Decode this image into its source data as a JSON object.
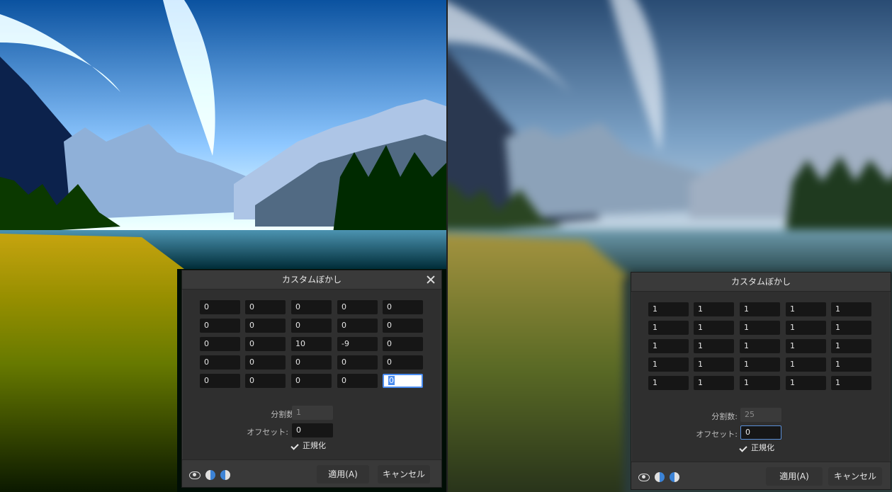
{
  "colors": {
    "dialog_bg": "#2f2f2f",
    "title_bar": "#3a3a3a",
    "cell_bg": "#161616",
    "accent": "#4a8cf0"
  },
  "left_dialog": {
    "title": "カスタムぼかし",
    "matrix": [
      [
        "0",
        "0",
        "0",
        "0",
        "0"
      ],
      [
        "0",
        "0",
        "0",
        "0",
        "0"
      ],
      [
        "0",
        "0",
        "10",
        "-9",
        "0"
      ],
      [
        "0",
        "0",
        "0",
        "0",
        "0"
      ],
      [
        "0",
        "0",
        "0",
        "0",
        "0"
      ]
    ],
    "division_label": "分割数:",
    "division_value": "1",
    "offset_label": "オフセット:",
    "offset_value": "0",
    "normalize_label": "正規化",
    "apply_label": "適用(A)",
    "cancel_label": "キャンセル"
  },
  "right_dialog": {
    "title": "カスタムぼかし",
    "matrix": [
      [
        "1",
        "1",
        "1",
        "1",
        "1"
      ],
      [
        "1",
        "1",
        "1",
        "1",
        "1"
      ],
      [
        "1",
        "1",
        "1",
        "1",
        "1"
      ],
      [
        "1",
        "1",
        "1",
        "1",
        "1"
      ],
      [
        "1",
        "1",
        "1",
        "1",
        "1"
      ]
    ],
    "division_label": "分割数:",
    "division_value": "25",
    "offset_label": "オフセット:",
    "offset_value": "0",
    "normalize_label": "正規化",
    "apply_label": "適用(A)",
    "cancel_label": "キャンセル"
  },
  "icons": [
    "eye-icon",
    "split-preview-icon",
    "split-preview-alt-icon",
    "close-icon",
    "checkmark-icon"
  ]
}
